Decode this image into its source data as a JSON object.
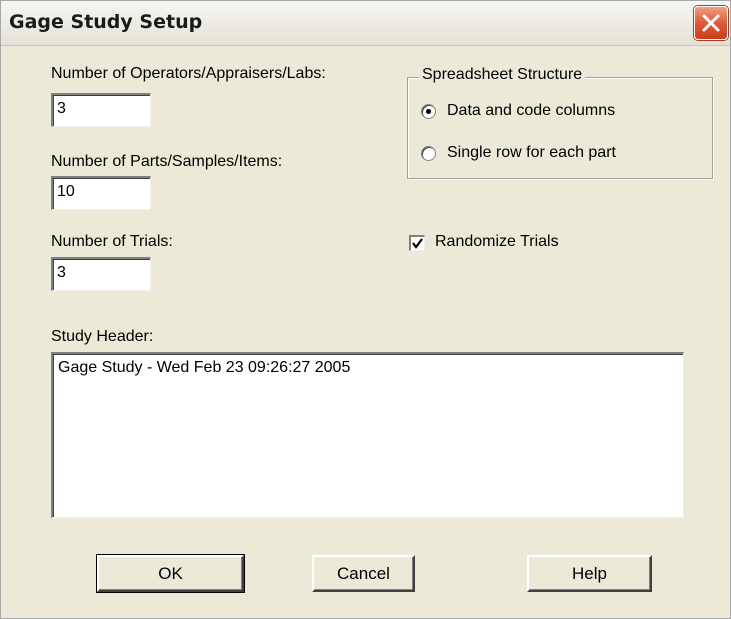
{
  "window": {
    "title": "Gage Study Setup"
  },
  "fields": {
    "operators_label": "Number of Operators/Appraisers/Labs:",
    "operators_value": "3",
    "parts_label": "Number of Parts/Samples/Items:",
    "parts_value": "10",
    "trials_label": "Number of Trials:",
    "trials_value": "3"
  },
  "spreadsheet_structure": {
    "title": "Spreadsheet Structure",
    "options": [
      {
        "label": "Data and code columns",
        "selected": true
      },
      {
        "label": "Single row for each part",
        "selected": false
      }
    ]
  },
  "randomize": {
    "label": "Randomize Trials",
    "checked": true
  },
  "header": {
    "label": "Study Header:",
    "value": "Gage Study - Wed Feb 23 09:26:27 2005"
  },
  "buttons": {
    "ok": "OK",
    "cancel": "Cancel",
    "help": "Help"
  },
  "colors": {
    "dialog_background": "#ece9d8",
    "close_button": "#e0583a"
  },
  "icons": {
    "close": "close-icon",
    "checkmark": "checkmark-icon"
  }
}
